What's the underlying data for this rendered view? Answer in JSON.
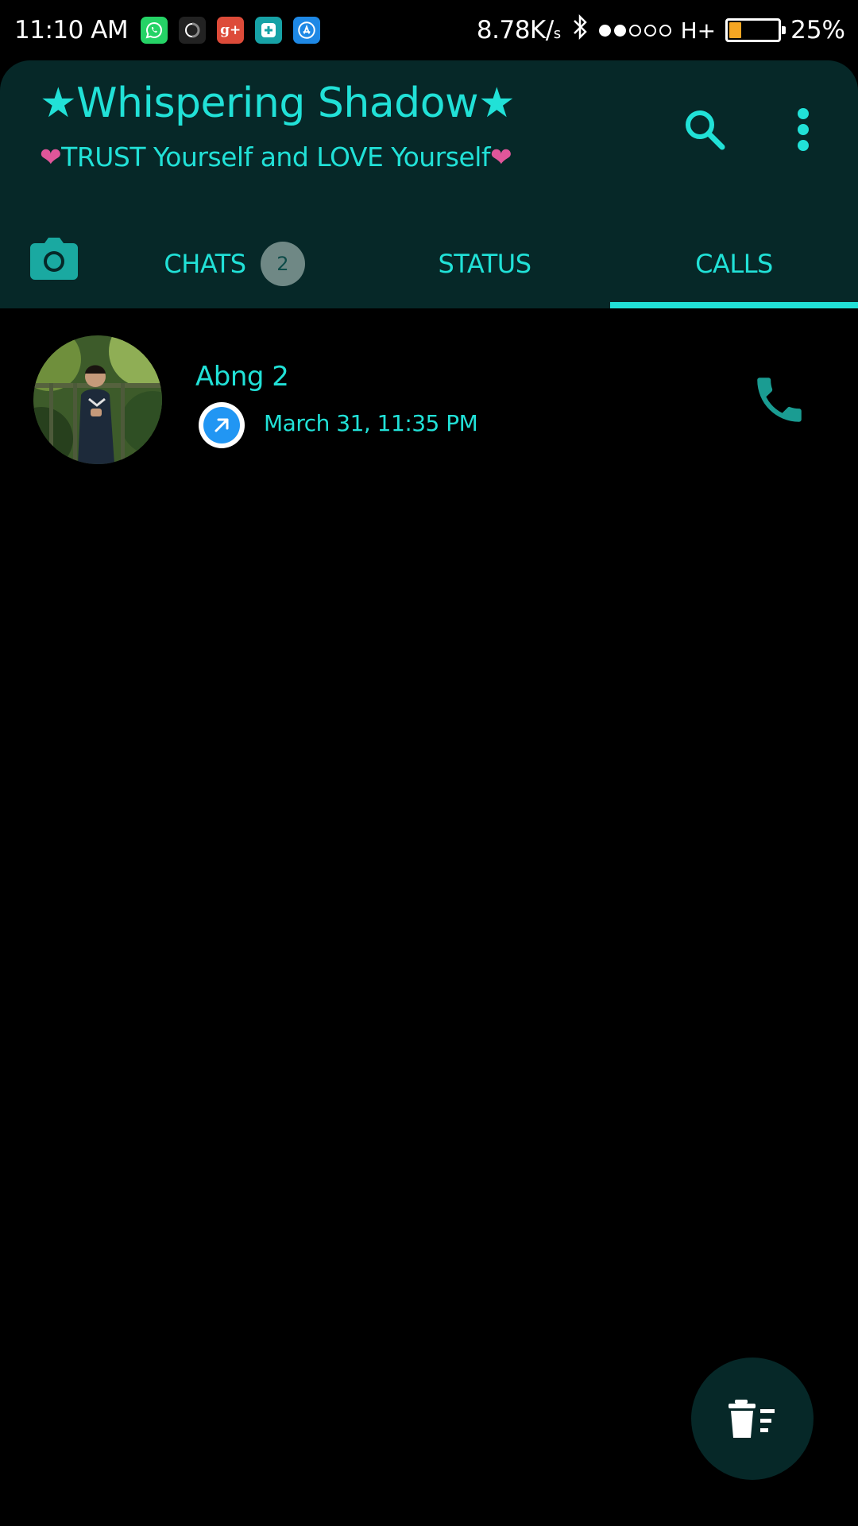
{
  "status_bar": {
    "time": "11:10 AM",
    "apps": [
      {
        "name": "whatsapp-icon",
        "color": "#25d366",
        "glyph": "✆"
      },
      {
        "name": "circle-app-icon",
        "color": "#222222",
        "glyph": "◯"
      },
      {
        "name": "google-plus-icon",
        "color": "#dd4b39",
        "glyph": "g+"
      },
      {
        "name": "add-app-icon",
        "color": "#17a2a6",
        "glyph": "+"
      },
      {
        "name": "app-store-icon",
        "color": "#1e88e5",
        "glyph": "A"
      }
    ],
    "net_speed": "8.78K/",
    "net_speed_unit": "s",
    "network_type": "H+",
    "signal_bars_filled": 2,
    "signal_bars_total": 5,
    "battery_percent": "25%",
    "battery_level": 0.25
  },
  "header": {
    "title": "★Whispering Shadow★",
    "subtitle_text": "TRUST Yourself and LOVE Yourself",
    "heart_glyph": "❤",
    "search_icon": "search-icon",
    "menu_icon": "more-vertical-icon"
  },
  "tabs": {
    "camera_icon": "camera-icon",
    "chats_label": "CHATS",
    "chats_badge": "2",
    "status_label": "STATUS",
    "calls_label": "CALLS",
    "active": "calls"
  },
  "calls": [
    {
      "name": "Abng 2",
      "direction": "outgoing",
      "time": "March 31, 11:35 PM",
      "action_icon": "phone-icon"
    }
  ],
  "fab_icon": "clear-call-log-icon",
  "colors": {
    "accent": "#21e1d7",
    "header_bg": "#062828",
    "background": "#000000",
    "heart": "#e0569a",
    "outgoing_call": "#2196f3"
  }
}
